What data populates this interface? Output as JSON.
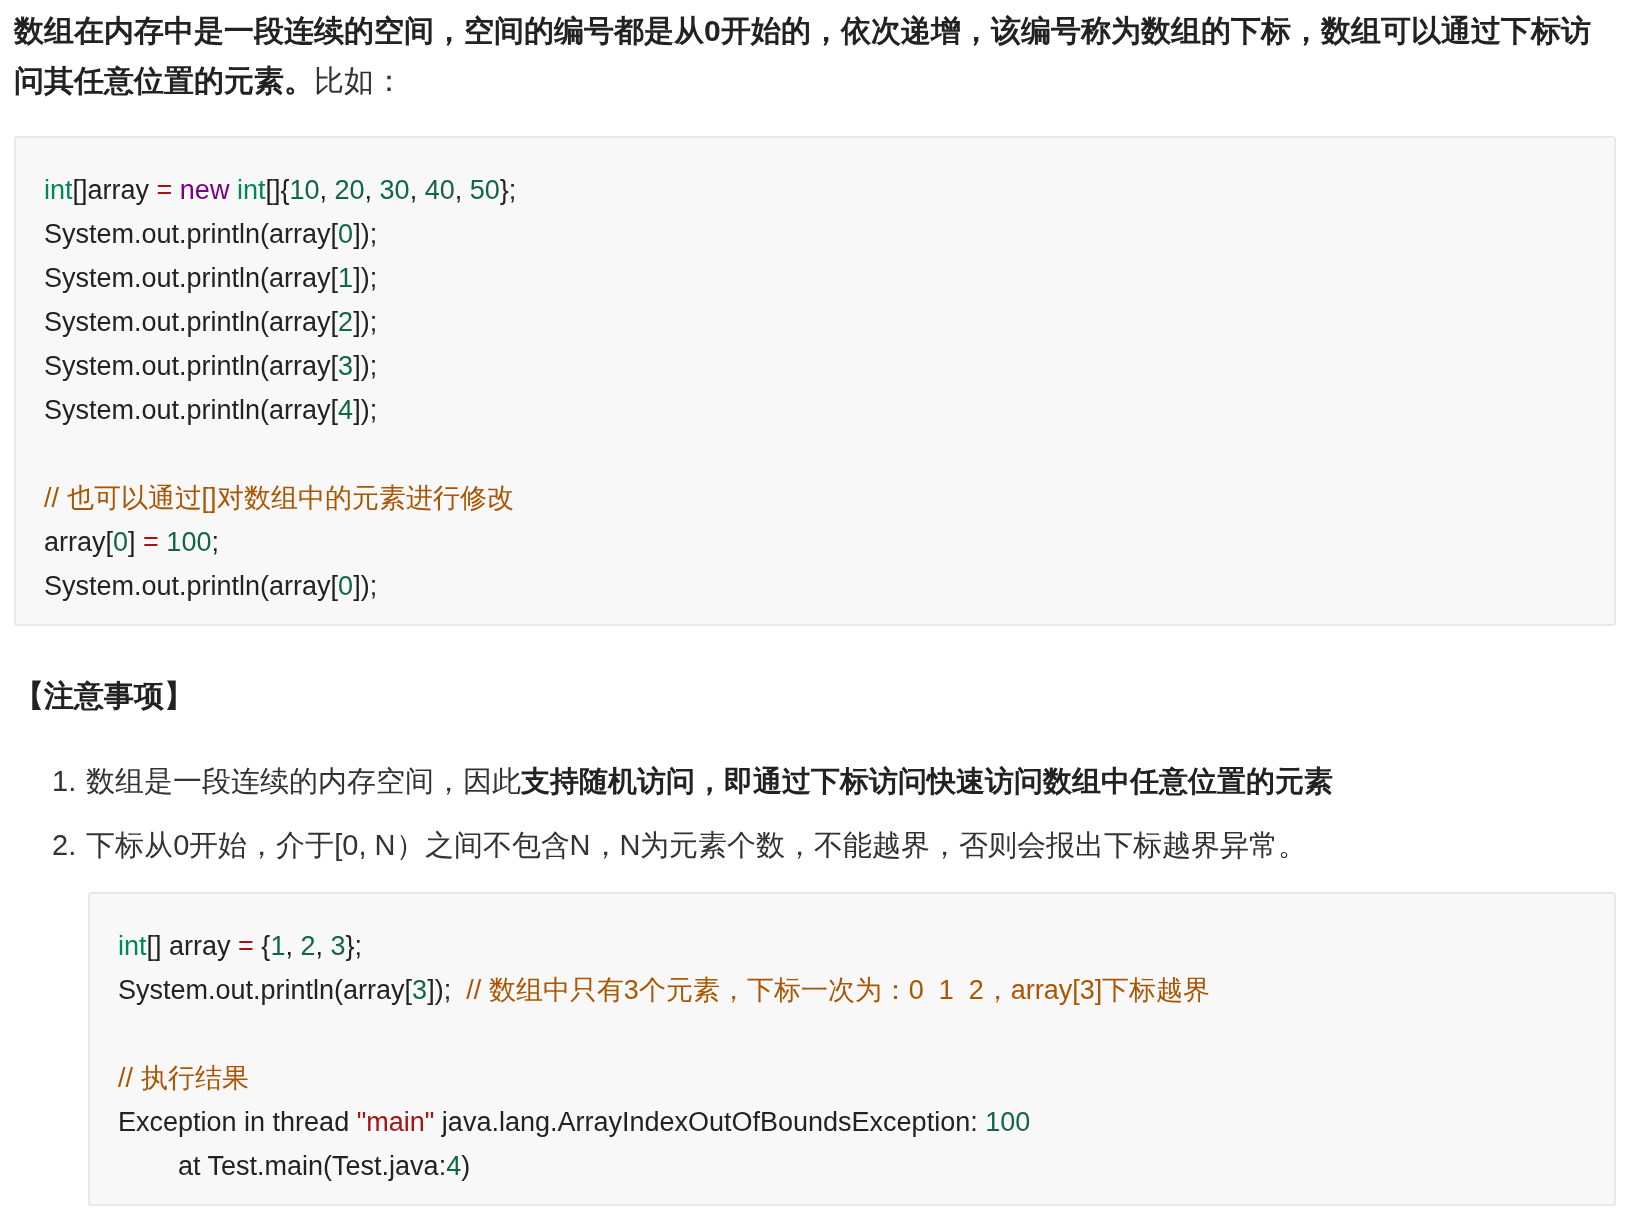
{
  "intro": "**数组在内存中是一段连续的空间，空间的编号都是从0开始的，依次递增，该编号称为数组的下标，数组可以通过下标访问其任意位置的元素。**比如：",
  "code_block_1": [
    {
      "kind": "code",
      "tokens": [
        {
          "kind": "type",
          "text": "int"
        },
        {
          "kind": "plain",
          "text": "[]array "
        },
        {
          "kind": "op",
          "text": "= "
        },
        {
          "kind": "keyword",
          "text": "new "
        },
        {
          "kind": "type",
          "text": "int"
        },
        {
          "kind": "plain",
          "text": "[]{"
        },
        {
          "kind": "number",
          "text": "10"
        },
        {
          "kind": "plain",
          "text": ", "
        },
        {
          "kind": "number",
          "text": "20"
        },
        {
          "kind": "plain",
          "text": ", "
        },
        {
          "kind": "number",
          "text": "30"
        },
        {
          "kind": "plain",
          "text": ", "
        },
        {
          "kind": "number",
          "text": "40"
        },
        {
          "kind": "plain",
          "text": ", "
        },
        {
          "kind": "number",
          "text": "50"
        },
        {
          "kind": "plain",
          "text": "};"
        }
      ]
    },
    {
      "kind": "code",
      "tokens": [
        {
          "kind": "plain",
          "text": "System.out.println(array["
        },
        {
          "kind": "number",
          "text": "0"
        },
        {
          "kind": "plain",
          "text": "]);"
        }
      ]
    },
    {
      "kind": "code",
      "tokens": [
        {
          "kind": "plain",
          "text": "System.out.println(array["
        },
        {
          "kind": "number",
          "text": "1"
        },
        {
          "kind": "plain",
          "text": "]);"
        }
      ]
    },
    {
      "kind": "code",
      "tokens": [
        {
          "kind": "plain",
          "text": "System.out.println(array["
        },
        {
          "kind": "number",
          "text": "2"
        },
        {
          "kind": "plain",
          "text": "]);"
        }
      ]
    },
    {
      "kind": "code",
      "tokens": [
        {
          "kind": "plain",
          "text": "System.out.println(array["
        },
        {
          "kind": "number",
          "text": "3"
        },
        {
          "kind": "plain",
          "text": "]);"
        }
      ]
    },
    {
      "kind": "code",
      "tokens": [
        {
          "kind": "plain",
          "text": "System.out.println(array["
        },
        {
          "kind": "number",
          "text": "4"
        },
        {
          "kind": "plain",
          "text": "]);"
        }
      ]
    },
    {
      "kind": "blank"
    },
    {
      "kind": "code",
      "tokens": [
        {
          "kind": "comment",
          "text": "// 也可以通过[]对数组中的元素进行修改"
        }
      ]
    },
    {
      "kind": "code",
      "tokens": [
        {
          "kind": "plain",
          "text": "array["
        },
        {
          "kind": "number",
          "text": "0"
        },
        {
          "kind": "plain",
          "text": "] "
        },
        {
          "kind": "op",
          "text": "= "
        },
        {
          "kind": "number",
          "text": "100"
        },
        {
          "kind": "plain",
          "text": ";"
        }
      ]
    },
    {
      "kind": "code",
      "tokens": [
        {
          "kind": "plain",
          "text": "System.out.println(array["
        },
        {
          "kind": "number",
          "text": "0"
        },
        {
          "kind": "plain",
          "text": "]);"
        }
      ]
    }
  ],
  "notes_heading": "【注意事项】",
  "notes": [
    {
      "marker": "1.",
      "text": "数组是一段连续的内存空间，因此**支持随机访问，即通过下标访问快速访问数组中任意位置的元素**"
    },
    {
      "marker": "2.",
      "text": "下标从0开始，介于[0, N）之间不包含N，N为元素个数，不能越界，否则会报出下标越界异常。"
    }
  ],
  "code_block_2": [
    {
      "kind": "code",
      "tokens": [
        {
          "kind": "type",
          "text": "int"
        },
        {
          "kind": "plain",
          "text": "[] array "
        },
        {
          "kind": "op",
          "text": "="
        },
        {
          "kind": "plain",
          "text": " {"
        },
        {
          "kind": "number",
          "text": "1"
        },
        {
          "kind": "plain",
          "text": ", "
        },
        {
          "kind": "number",
          "text": "2"
        },
        {
          "kind": "plain",
          "text": ", "
        },
        {
          "kind": "number",
          "text": "3"
        },
        {
          "kind": "plain",
          "text": "};"
        }
      ]
    },
    {
      "kind": "code",
      "tokens": [
        {
          "kind": "plain",
          "text": "System.out.println(array["
        },
        {
          "kind": "number",
          "text": "3"
        },
        {
          "kind": "plain",
          "text": "]);  "
        },
        {
          "kind": "comment",
          "text": "// 数组中只有3个元素，下标一次为：0  1  2，array[3]下标越界"
        }
      ]
    },
    {
      "kind": "blank"
    },
    {
      "kind": "code",
      "tokens": [
        {
          "kind": "comment",
          "text": "// 执行结果"
        }
      ]
    },
    {
      "kind": "code",
      "tokens": [
        {
          "kind": "plain",
          "text": "Exception in thread "
        },
        {
          "kind": "string",
          "text": "\"main\""
        },
        {
          "kind": "plain",
          "text": " java.lang.ArrayIndexOutOfBoundsException: "
        },
        {
          "kind": "number",
          "text": "100"
        }
      ]
    },
    {
      "kind": "code",
      "tokens": [
        {
          "kind": "plain",
          "text": "        at Test.main(Test.java:"
        },
        {
          "kind": "number",
          "text": "4"
        },
        {
          "kind": "plain",
          "text": ")"
        }
      ]
    }
  ]
}
